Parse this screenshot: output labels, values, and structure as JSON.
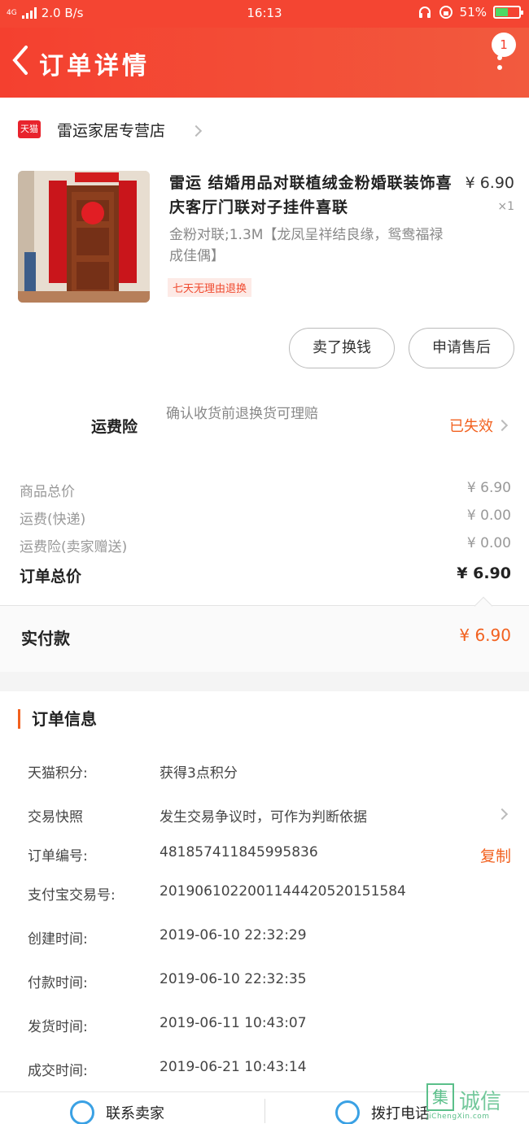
{
  "status_bar": {
    "network": "4G",
    "speed": "2.0 B/s",
    "time": "16:13",
    "battery": "51%",
    "battery_level_percent": 51
  },
  "header": {
    "title": "订单详情",
    "notification_count": "1"
  },
  "shop": {
    "platform_logo": "天猫",
    "name": "雷运家居专营店"
  },
  "product": {
    "title": "雷运 结婚用品对联植绒金粉婚联装饰喜庆客厅门联对子挂件喜联",
    "sku": "金粉对联;1.3M【龙凤呈祥结良缘，鸳鸯福禄成佳偶】",
    "tag": "七天无理由退换",
    "price": "¥ 6.90",
    "quantity": "×1",
    "buttons": {
      "buy_again": "卖了换钱",
      "after_sale": "申请售后"
    }
  },
  "insurance": {
    "label": "运费险",
    "desc": "确认收货前退换货可理赔",
    "status": "已失效"
  },
  "summary": {
    "goods_total_label": "商品总价",
    "goods_total": "¥ 6.90",
    "shipping_label": "运费(快递)",
    "shipping": "¥ 0.00",
    "insurance_label": "运费险(卖家赠送)",
    "insurance": "¥ 0.00",
    "order_total_label": "订单总价",
    "order_total": "¥ 6.90"
  },
  "paid": {
    "label": "实付款",
    "value": "¥ 6.90"
  },
  "order_info": {
    "title": "订单信息",
    "rows": [
      {
        "key": "天猫积分:",
        "value": "获得3点积分"
      },
      {
        "key": "交易快照",
        "value": "发生交易争议时，可作为判断依据"
      },
      {
        "key": "订单编号:",
        "value": "481857411845995836",
        "action": "复制"
      },
      {
        "key": "支付宝交易号:",
        "value": "2019061022001144420520151584"
      },
      {
        "key": "创建时间:",
        "value": "2019-06-10 22:32:29"
      },
      {
        "key": "付款时间:",
        "value": "2019-06-10 22:32:35"
      },
      {
        "key": "发货时间:",
        "value": "2019-06-11 10:43:07"
      },
      {
        "key": "成交时间:",
        "value": "2019-06-21 10:43:14"
      }
    ]
  },
  "bottom_bar": {
    "contact_seller": "联系卖家",
    "call_seller": "拨打电话"
  },
  "watermark": {
    "char": "集",
    "text": "诚信",
    "sub": "JiChengXin.com"
  }
}
